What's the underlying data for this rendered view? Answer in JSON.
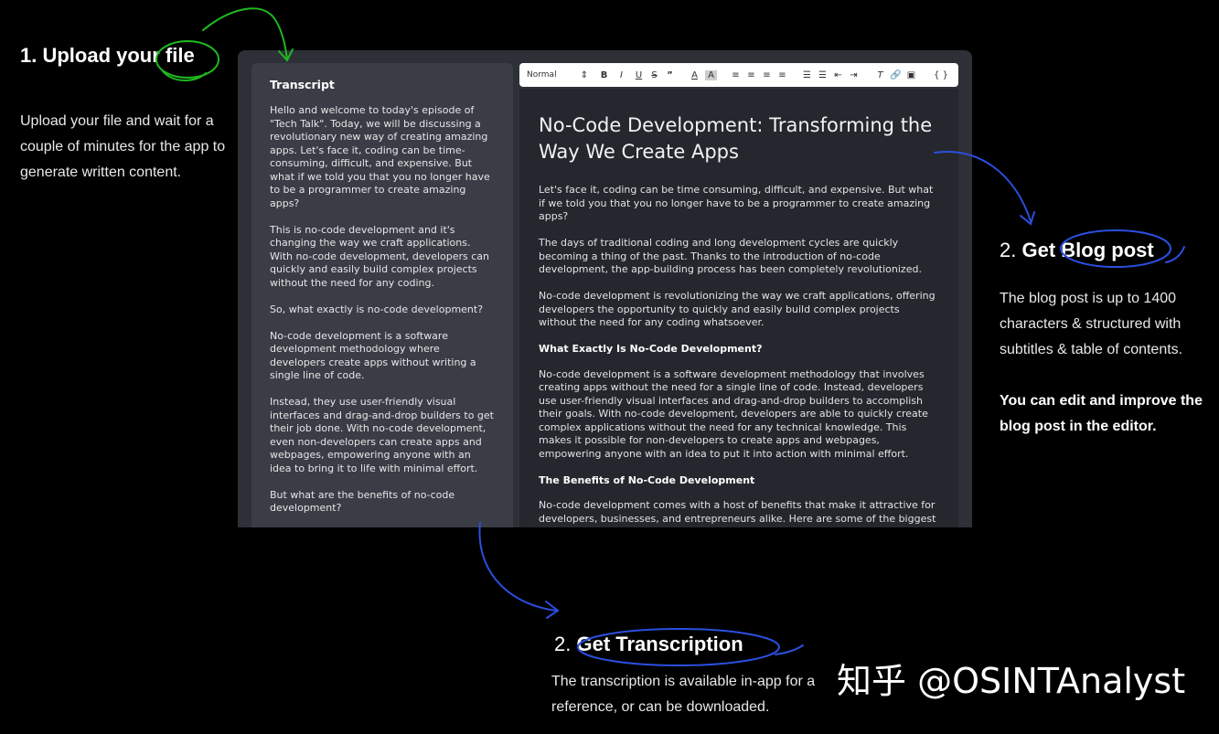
{
  "steps": {
    "upload": {
      "title": "1. Upload your file",
      "desc": "Upload your file and wait for a couple of minutes for the app to generate written content."
    },
    "blog": {
      "title_num": "2.",
      "title": "Get Blog post",
      "desc": "The blog post is up to 1400 characters & structured with subtitles & table of contents.",
      "bold": "You can edit and improve the blog post in the editor."
    },
    "transcription": {
      "title_num": "2.",
      "title": "Get Transcription",
      "desc": "The transcription is available in-app for a reference, or can be downloaded."
    }
  },
  "watermark": "知乎 @OSINTAnalyst",
  "transcript": {
    "heading": "Transcript",
    "paragraphs": [
      "Hello and welcome to today's episode of \"Tech Talk\". Today, we will be discussing a revolutionary new way of creating amazing apps. Let's face it, coding can be time-consuming, difficult, and expensive. But what if we told you that you no longer have to be a programmer to create amazing apps?",
      "This is no-code development and it's changing the way we craft applications. With no-code development, developers can quickly and easily build complex projects without the need for any coding.",
      "So, what exactly is no-code development?",
      "No-code development is a software development methodology where developers create apps without writing a single line of code.",
      "Instead, they use user-friendly visual interfaces and drag-and-drop builders to get their job done. With no-code development, even non-developers can create apps and webpages, empowering anyone with an idea to bring it to life with minimal effort.",
      "But what are the benefits of no-code development?"
    ]
  },
  "toolbar": {
    "format": "Normal",
    "icons": [
      "bold-icon",
      "italic-icon",
      "underline-icon",
      "strike-icon",
      "quote-icon",
      "font-color-icon",
      "background-color-icon",
      "align-left-icon",
      "align-center-icon",
      "align-right-icon",
      "align-justify-icon",
      "ordered-list-icon",
      "bullet-list-icon",
      "outdent-icon",
      "indent-icon",
      "clear-format-icon",
      "link-icon",
      "image-icon",
      "code-block-icon"
    ]
  },
  "editor": {
    "title": "No-Code Development: Transforming the Way We Create Apps",
    "p1": "Let's face it, coding can be time consuming, difficult, and expensive. But what if we told you that you no longer have to be a programmer to create amazing apps?",
    "p2": "The days of traditional coding and long development cycles are quickly becoming a thing of the past. Thanks to the introduction of no-code development, the app-building process has been completely revolutionized.",
    "p3": "No-code development is revolutionizing the way we craft applications, offering developers the opportunity to quickly and easily build complex projects without the need for any coding whatsoever.",
    "h1": "What Exactly Is No-Code Development?",
    "p4": "No-code development is a software development methodology that involves creating apps without the need for a single line of code. Instead, developers use user-friendly visual interfaces and drag-and-drop builders to accomplish their goals. With no-code development, developers are able to quickly create complex applications without the need for any technical knowledge. This makes it possible for non-developers to create apps and webpages, empowering anyone with an idea to put it into action with minimal effort.",
    "h2": "The Benefits of No-Code Development",
    "p5": "No-code development comes with a host of benefits that make it attractive for developers, businesses, and entrepreneurs alike. Here are some of the biggest"
  },
  "colors": {
    "green_ink": "#1fb81f",
    "blue_ink": "#2b4fe0",
    "frame": "#2e3037",
    "transcript_bg": "#3a3d46",
    "editor_bg": "#25272e"
  }
}
